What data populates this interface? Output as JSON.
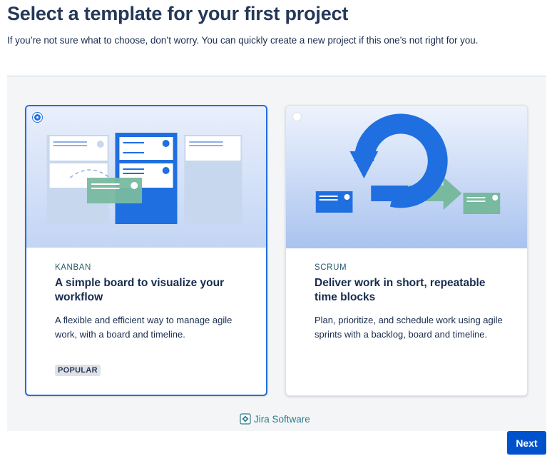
{
  "header": {
    "title": "Select a template for your first project",
    "subtitle": "If you’re not sure what to choose, don’t worry. You can quickly create a new project if this one’s not right for you."
  },
  "templates": [
    {
      "category": "KANBAN",
      "heading": "A simple board to visualize your workflow",
      "description": "A flexible and efficient way to manage agile work, with a board and timeline.",
      "badge": "POPULAR",
      "selected": true,
      "icon": "kanban-board-illustration"
    },
    {
      "category": "SCRUM",
      "heading": "Deliver work in short, repeatable time blocks",
      "description": "Plan, prioritize, and schedule work using agile sprints with a backlog, board and timeline.",
      "selected": false,
      "icon": "scrum-cycle-illustration"
    }
  ],
  "footer": {
    "brand": "Jira Software",
    "brand_icon": "jira-software-logo-icon"
  },
  "actions": {
    "next_label": "Next"
  },
  "colors": {
    "primary": "#0052cc",
    "selected_border": "#1f6fe0",
    "panel_bg": "#f4f5f7",
    "accent_green": "#79b9a0",
    "brand_teal": "#2f7a8a"
  }
}
